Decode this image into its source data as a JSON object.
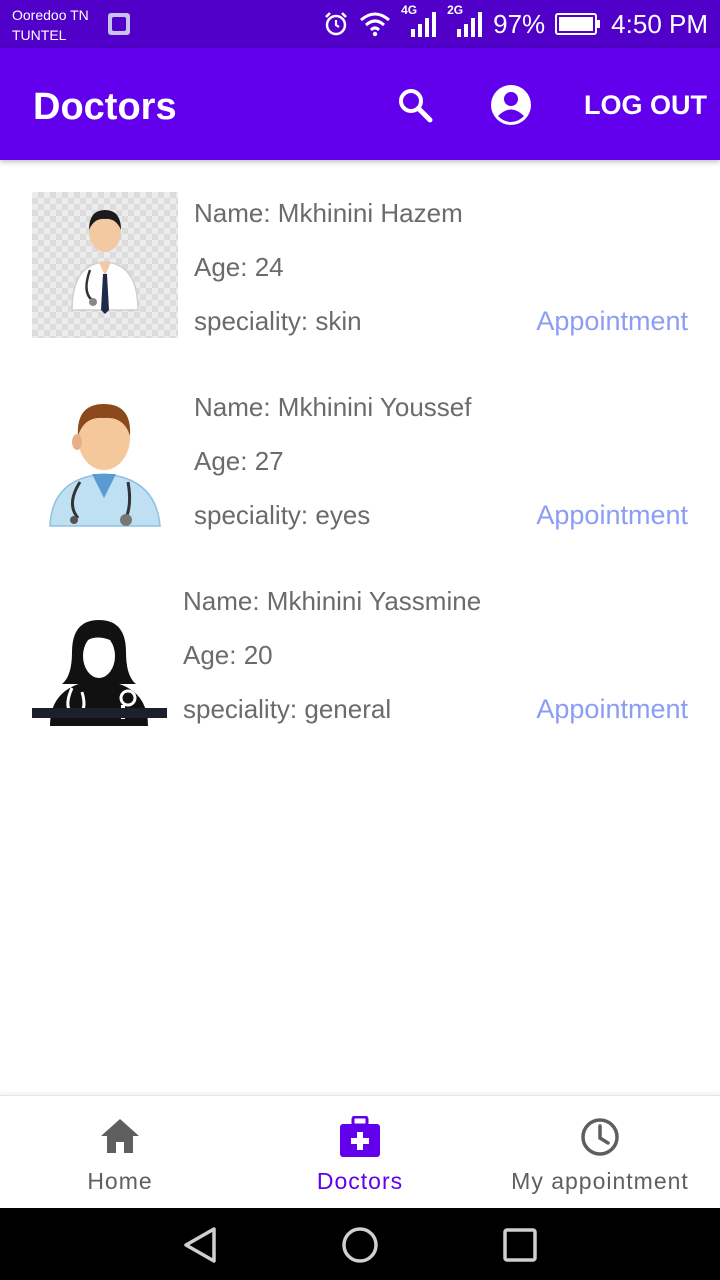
{
  "status_bar": {
    "carrier": "Ooredoo TN",
    "carrier2": "TUNTEL",
    "network_4g": "4G",
    "network_2g": "2G",
    "battery": "97%",
    "time": "4:50 PM"
  },
  "app_bar": {
    "title": "Doctors",
    "logout_label": "LOG OUT"
  },
  "doctors": [
    {
      "name": "Name: Mkhinini Hazem",
      "age": "Age: 24",
      "speciality": "speciality: skin",
      "action": "Appointment"
    },
    {
      "name": "Name: Mkhinini Youssef",
      "age": "Age: 27",
      "speciality": "speciality: eyes",
      "action": "Appointment"
    },
    {
      "name": "Name: Mkhinini Yassmine",
      "age": "Age: 20",
      "speciality": "speciality: general",
      "action": "Appointment"
    }
  ],
  "bottom_nav": {
    "items": [
      {
        "label": "Home",
        "icon": "home-icon",
        "active": false
      },
      {
        "label": "Doctors",
        "icon": "medical-bag-icon",
        "active": true
      },
      {
        "label": "My appointment",
        "icon": "clock-icon",
        "active": false
      }
    ]
  },
  "colors": {
    "status_bar": "#5000c8",
    "app_bar": "#6200ee",
    "link": "#8c9df5",
    "nav_active": "#6200ee",
    "nav_inactive": "#5f5f5f"
  }
}
